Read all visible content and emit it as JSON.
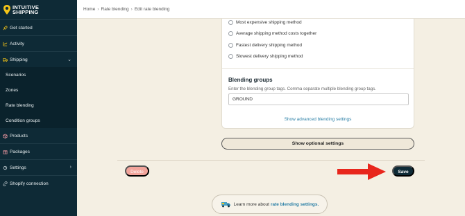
{
  "brand": {
    "line1": "INTUITIVE",
    "line2": "SHIPPING",
    "logo_icon": "location-pin-icon",
    "accent": "#f5c518"
  },
  "sidebar": {
    "items": [
      {
        "label": "Get started",
        "icon": "rocket-icon"
      },
      {
        "label": "Activity",
        "icon": "chart-icon"
      },
      {
        "label": "Shipping",
        "icon": "truck-icon",
        "expanded": true
      },
      {
        "label": "Products",
        "icon": "box-icon"
      },
      {
        "label": "Packages",
        "icon": "package-icon"
      },
      {
        "label": "Settings",
        "icon": "gear-icon"
      },
      {
        "label": "Shopify connection",
        "icon": "link-icon"
      }
    ],
    "shipping_sub": [
      "Scenarios",
      "Zones",
      "Rate blending",
      "Condition groups"
    ]
  },
  "breadcrumb": {
    "home": "Home",
    "sep1": "›",
    "rate_blending": "Rate blending",
    "sep2": "›",
    "current": "Edit rate blending"
  },
  "rate_methods": [
    "Most expensive shipping method",
    "Average shipping method costs together",
    "Fastest delivery shipping method",
    "Slowest delivery shipping method"
  ],
  "blending_groups": {
    "title": "Blending groups",
    "help": "Enter the blending group tags. Comma separate multiple blending group tags.",
    "value": "GROUND",
    "advanced_link": "Show advanced blending settings"
  },
  "optional_button": "Show optional settings",
  "actions": {
    "delete": "Delete",
    "save": "Save"
  },
  "learn_more": {
    "prefix": "Learn more about",
    "link": "rate blending settings."
  },
  "colors": {
    "sidebar_bg": "#0e2a36",
    "page_bg": "#f4efe3",
    "link": "#2a7fa6",
    "delete": "#f2a49b",
    "arrow": "#e8261c"
  }
}
